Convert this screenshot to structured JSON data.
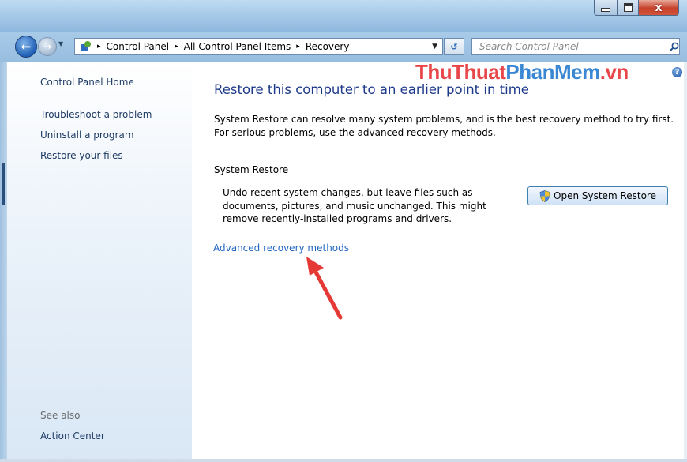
{
  "window": {
    "minimize_label": "",
    "maximize_label": "",
    "close_label": "x"
  },
  "nav": {
    "breadcrumbs": [
      "Control Panel",
      "All Control Panel Items",
      "Recovery"
    ],
    "separator": "▸",
    "search_placeholder": "Search Control Panel"
  },
  "sidebar": {
    "home": "Control Panel Home",
    "links": [
      "Troubleshoot a problem",
      "Uninstall a program",
      "Restore your files"
    ],
    "see_also_label": "See also",
    "see_also_links": [
      "Action Center"
    ]
  },
  "main": {
    "watermark_part1": "ThuThuat",
    "watermark_part2": "PhanMem",
    "watermark_part3": ".vn",
    "title": "Restore this computer to an earlier point in time",
    "intro": "System Restore can resolve many system problems, and is the best recovery method to try first. For serious problems, use the advanced recovery methods.",
    "system_restore": {
      "label": "System Restore",
      "description": "Undo recent system changes, but leave files such as documents, pictures, and music unchanged. This might remove recently-installed programs and drivers.",
      "button_label": "Open System Restore"
    },
    "advanced_link": "Advanced recovery methods"
  },
  "colors": {
    "link": "#1f66c2",
    "title": "#1e3a8a",
    "watermark_red": "#e8474a",
    "watermark_blue": "#3a88d3",
    "annotation_arrow": "#e53935"
  }
}
